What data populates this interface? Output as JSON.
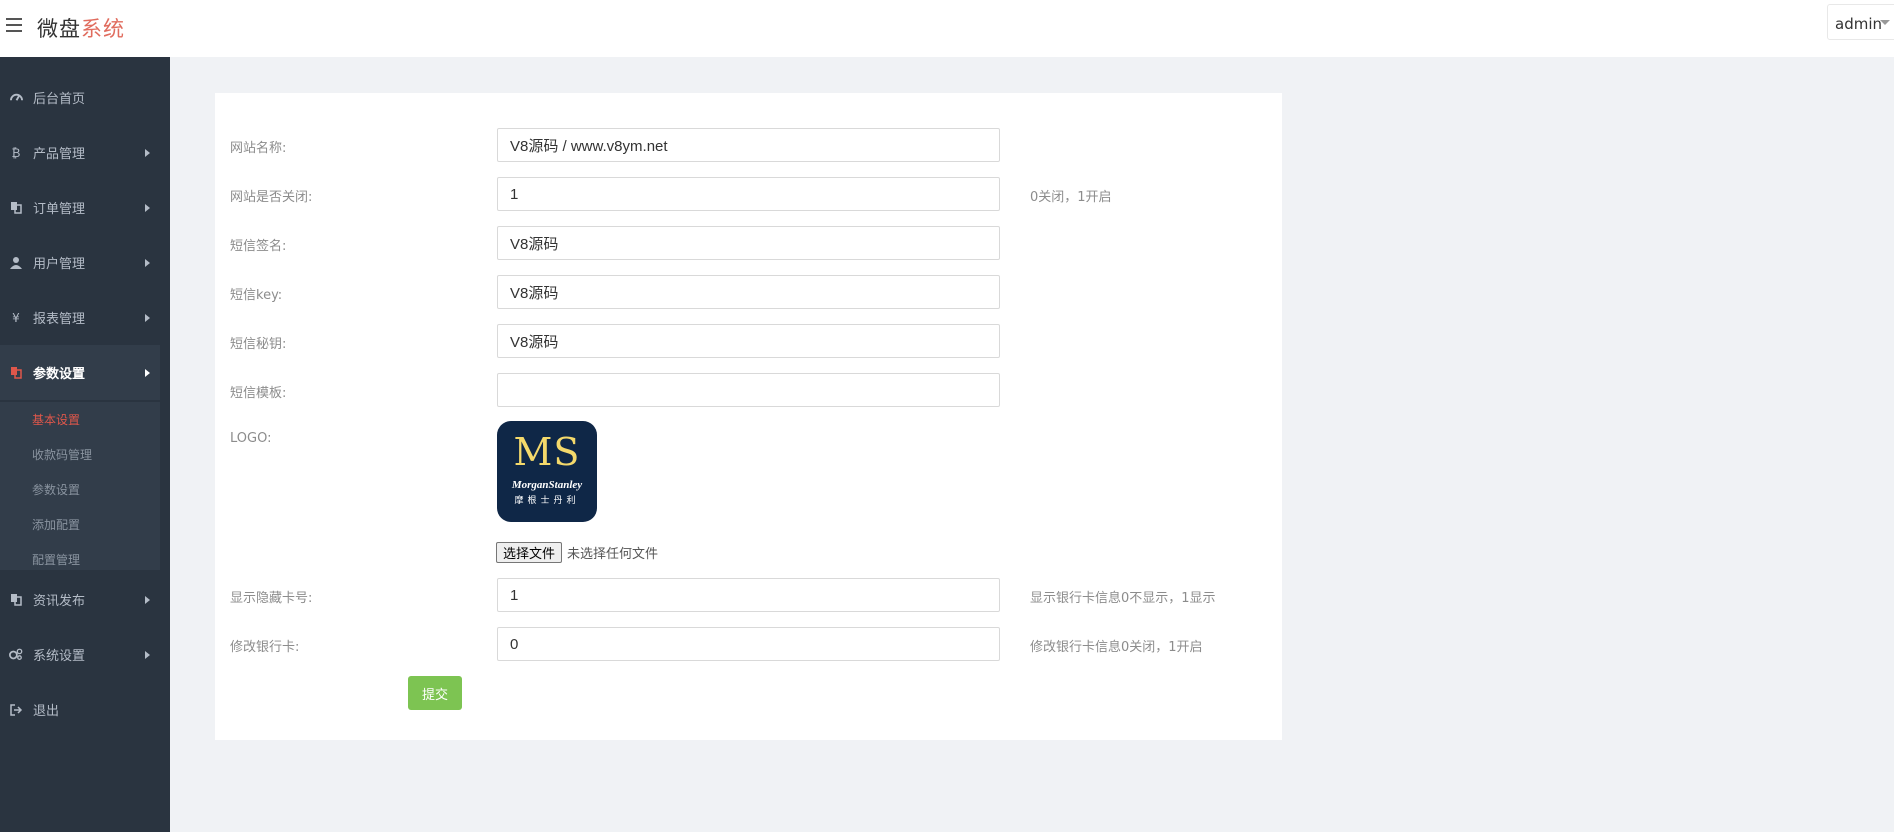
{
  "header": {
    "brand_main": "微盘",
    "brand_accent": "系统",
    "user": "admin"
  },
  "sidebar": {
    "items": [
      {
        "label": "后台首页",
        "icon": "dashboard-icon"
      },
      {
        "label": "产品管理",
        "icon": "bitcoin-icon"
      },
      {
        "label": "订单管理",
        "icon": "copy-icon"
      },
      {
        "label": "用户管理",
        "icon": "user-icon"
      },
      {
        "label": "报表管理",
        "icon": "yen-icon"
      },
      {
        "label": "参数设置",
        "icon": "copy-icon"
      },
      {
        "label": "资讯发布",
        "icon": "copy-icon"
      },
      {
        "label": "系统设置",
        "icon": "gears-icon"
      },
      {
        "label": "退出",
        "icon": "sign-out-icon"
      }
    ],
    "submenu": [
      {
        "label": "基本设置"
      },
      {
        "label": "收款码管理"
      },
      {
        "label": "参数设置"
      },
      {
        "label": "添加配置"
      },
      {
        "label": "配置管理"
      }
    ]
  },
  "form": {
    "site_name": {
      "label": "网站名称:",
      "value": "V8源码 / www.v8ym.net"
    },
    "site_closed": {
      "label": "网站是否关闭:",
      "value": "1",
      "help": "0关闭，1开启"
    },
    "sms_sign": {
      "label": "短信签名:",
      "value": "V8源码"
    },
    "sms_key": {
      "label": "短信key:",
      "value": "V8源码"
    },
    "sms_secret": {
      "label": "短信秘钥:",
      "value": "V8源码"
    },
    "sms_template": {
      "label": "短信模板:",
      "value": ""
    },
    "logo": {
      "label": "LOGO:",
      "text_ms": "MS",
      "text_name": "MorganStanley",
      "text_cn": "摩根士丹利",
      "file_button": "选择文件",
      "file_status": "未选择任何文件"
    },
    "show_card": {
      "label": "显示隐藏卡号:",
      "value": "1",
      "help": "显示银行卡信息0不显示，1显示"
    },
    "edit_card": {
      "label": "修改银行卡:",
      "value": "0",
      "help": "修改银行卡信息0关闭，1开启"
    },
    "submit": "提交"
  },
  "colors": {
    "sidebar_bg": "#2a3440",
    "brand_accent": "#e06c5e",
    "active_red": "#e0574b",
    "submit_green": "#7dc452",
    "logo_navy": "#0f2747",
    "logo_gold": "#f4d96b"
  }
}
